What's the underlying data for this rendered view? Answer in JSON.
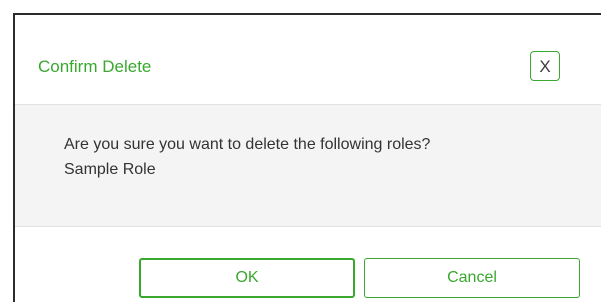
{
  "dialog": {
    "title": "Confirm Delete",
    "close_label": "X",
    "message_line1": "Are you sure you want to delete the following roles?",
    "message_line2": "Sample Role",
    "ok_label": "OK",
    "cancel_label": "Cancel"
  },
  "colors": {
    "accent": "#3aa82f",
    "body_bg": "#f4f4f4",
    "text": "#333333"
  }
}
